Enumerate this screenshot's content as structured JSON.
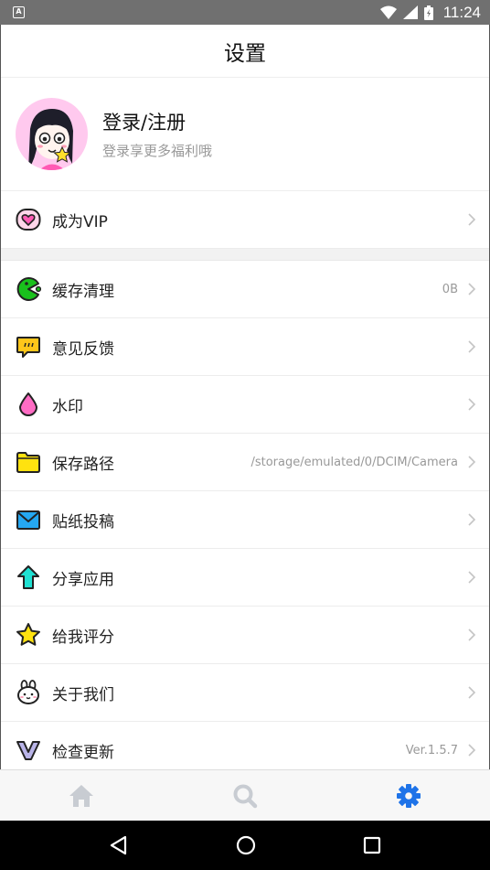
{
  "status_bar": {
    "notification_glyph": "A",
    "time": "11:24"
  },
  "header": {
    "title": "设置"
  },
  "profile": {
    "name": "登录/注册",
    "subtitle": "登录享更多福利哦"
  },
  "vip": {
    "label": "成为VIP",
    "icon": "heart-icon"
  },
  "settings": [
    {
      "label": "缓存清理",
      "value": "0B",
      "icon": "pacman-icon"
    },
    {
      "label": "意见反馈",
      "value": "",
      "icon": "chat-bubble-icon"
    },
    {
      "label": "水印",
      "value": "",
      "icon": "drop-icon"
    },
    {
      "label": "保存路径",
      "value": "/storage/emulated/0/DCIM/Camera",
      "icon": "folder-icon"
    },
    {
      "label": "贴纸投稿",
      "value": "",
      "icon": "mail-icon"
    },
    {
      "label": "分享应用",
      "value": "",
      "icon": "share-arrow-icon"
    },
    {
      "label": "给我评分",
      "value": "",
      "icon": "star-icon"
    },
    {
      "label": "关于我们",
      "value": "",
      "icon": "bunny-icon"
    },
    {
      "label": "检查更新",
      "value": "Ver.1.5.7",
      "icon": "v-logo-icon"
    }
  ],
  "bottom_nav": {
    "tabs": [
      "home-icon",
      "search-icon",
      "settings-gear-icon"
    ],
    "active": "settings-gear-icon"
  },
  "colors": {
    "accent": "#1e73e8",
    "inactive_tab": "#c8ccd2",
    "divider": "#ececec"
  }
}
